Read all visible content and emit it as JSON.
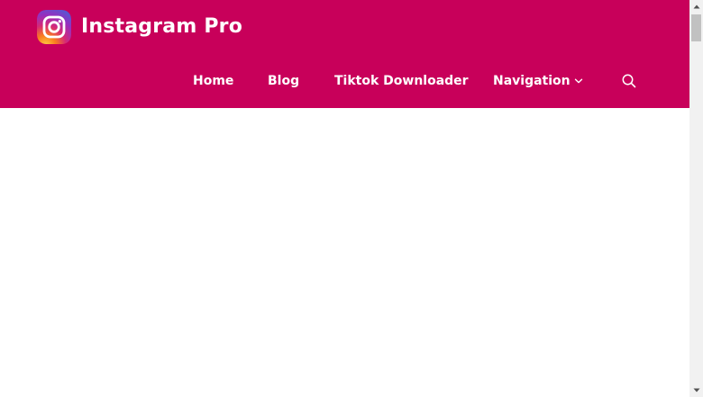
{
  "site": {
    "title": "Instagram Pro",
    "logo_icon": "instagram-logo-icon"
  },
  "nav": {
    "items": [
      {
        "label": "Home"
      },
      {
        "label": "Blog"
      },
      {
        "label": "Tiktok Downloader"
      },
      {
        "label": "Navigation",
        "has_dropdown": true
      }
    ],
    "dropdown_icon": "chevron-down-icon",
    "search_icon": "search-icon"
  },
  "colors": {
    "header_bg": "#c8005a",
    "header_text": "#ffffff",
    "page_bg": "#ffffff",
    "scrollbar_track": "#f1f1f1",
    "scrollbar_thumb": "#c1c1c1"
  }
}
